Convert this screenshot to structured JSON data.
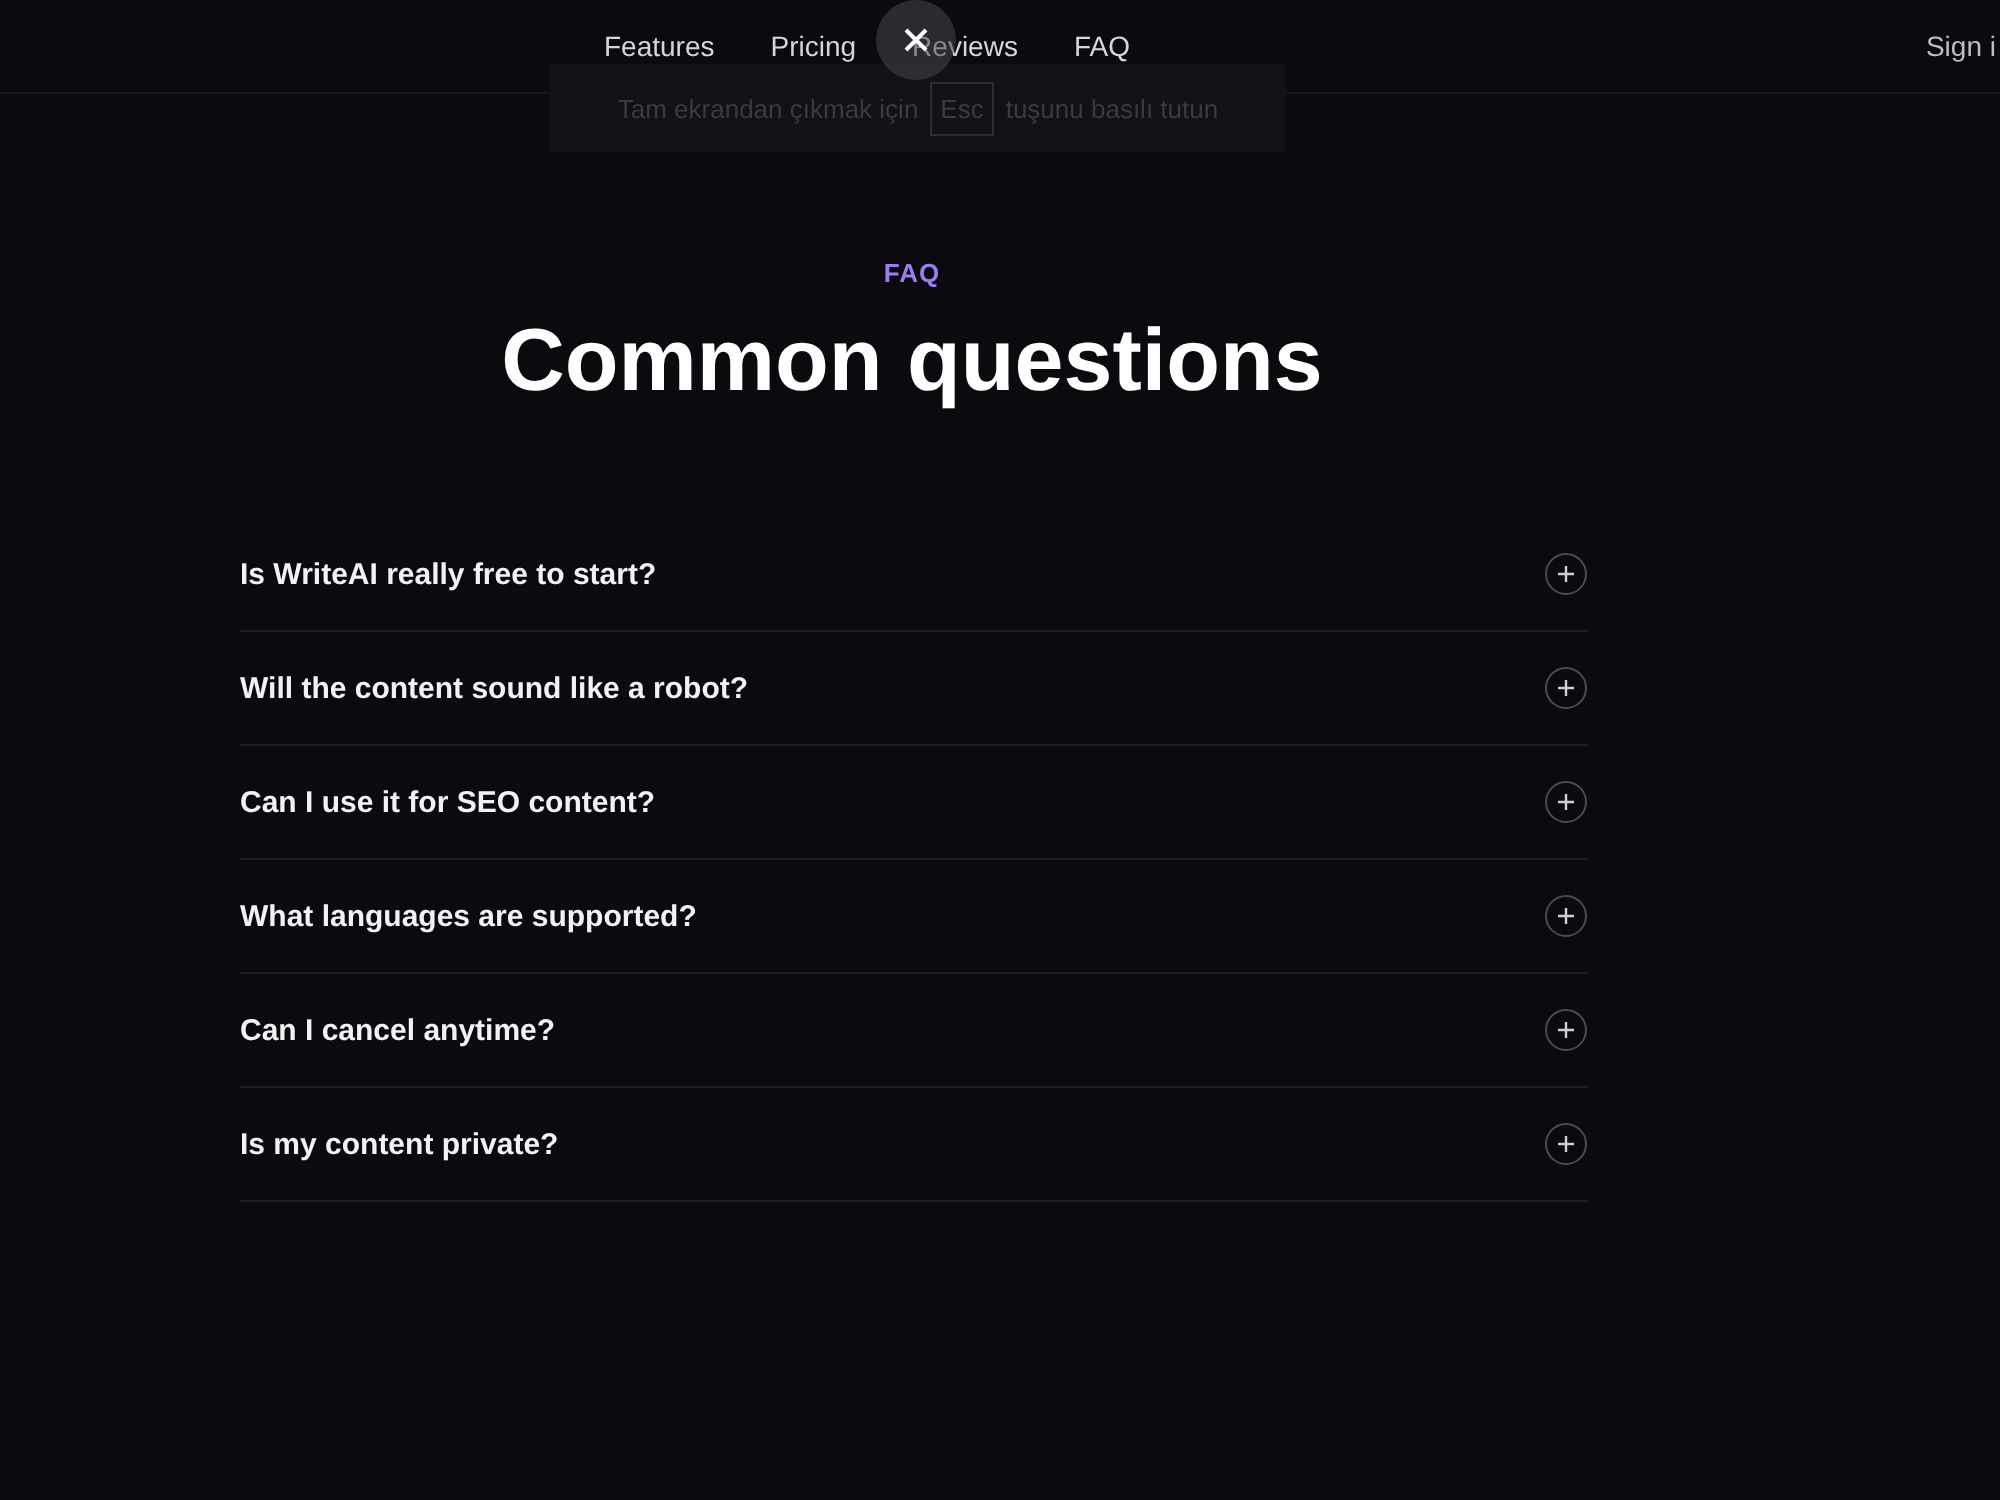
{
  "nav": {
    "links": [
      "Features",
      "Pricing",
      "Reviews",
      "FAQ"
    ],
    "sign_in": "Sign i"
  },
  "fullscreen_toast": {
    "before": "Tam ekrandan çıkmak için",
    "key": "Esc",
    "after": "tuşunu basılı tutun"
  },
  "faq": {
    "eyebrow": "FAQ",
    "title": "Common questions",
    "items": [
      {
        "question": "Is WriteAI really free to start?",
        "expanded": false
      },
      {
        "question": "Will the content sound like a robot?",
        "expanded": false
      },
      {
        "question": "Can I use it for SEO content?",
        "expanded": false
      },
      {
        "question": "What languages are supported?",
        "expanded": false
      },
      {
        "question": "Can I cancel anytime?",
        "expanded": false
      },
      {
        "question": "Is my content private?",
        "expanded": false
      }
    ]
  }
}
